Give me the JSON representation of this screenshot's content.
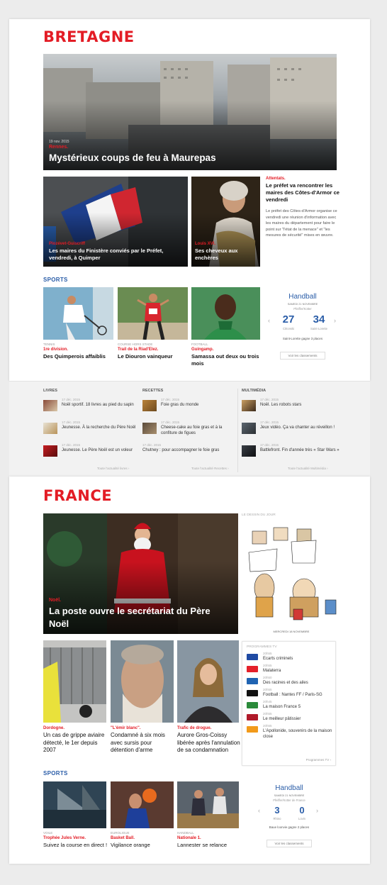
{
  "bretagne": {
    "title": "BRETAGNE",
    "hero": {
      "date": "19 nov. 2015",
      "kicker": "Rennes.",
      "title": "Mystérieux coups de feu à Maurepas"
    },
    "story2": {
      "kicker": "Plozévet-Guiscriff",
      "title": "Les maires du Finistère conviés par le Préfet, vendredi, à Quimper"
    },
    "story3": {
      "kicker": "Louis XVI.",
      "title": "Ses cheveux aux enchères"
    },
    "side": {
      "kicker": "Attentats.",
      "title": "Le préfet va rencontrer les maires des Côtes-d'Armor ce vendredi",
      "body": "Le préfet des Côtes-d'Armor organise ce vendredi une réunion d'information avec les maires du département pour faire le point sur \"l'état de la menace\" et \"les mesures de sécurité\" mises en œuvre."
    },
    "sports": {
      "heading": "SPORTS",
      "items": [
        {
          "cat": "TENNIS",
          "kicker": "1re division.",
          "title": "Des Quimperois affaiblis"
        },
        {
          "cat": "COURSE HORS STADE",
          "kicker": "Trail de la Riad'Elez.",
          "title": "Le Diouron vainqueur"
        },
        {
          "cat": "FOOTBALL",
          "kicker": "Guingamp.",
          "title": "Samassa out deux ou trois mois"
        }
      ],
      "widget": {
        "sport": "Handball",
        "date": "SAMEDI 21 NOVEMBRE",
        "league": "Pfeiffer/Kotter",
        "home_score": "27",
        "away_score": "34",
        "home_team": "Cléonski",
        "away_team": "Saint-Lorette",
        "summary": "Saint-Lorette gagne 3 places",
        "button": "Voir les classements"
      }
    }
  },
  "culture": {
    "livres": {
      "heading": "LIVRES",
      "items": [
        {
          "date": "17 déc. 2015",
          "text": "Noël sportif. 18 livres au pied du sapin"
        },
        {
          "date": "17 déc. 2015",
          "text": "Jeunesse. À la recherche du Père Noël"
        },
        {
          "date": "17 déc. 2015",
          "text": "Jeunesse. Le Père Noël est un voleur"
        }
      ],
      "more": "Toute l'actualité livres ›"
    },
    "recettes": {
      "heading": "RECETTES",
      "items": [
        {
          "date": "17 déc. 2015",
          "text": "Foie gras du monde"
        },
        {
          "date": "17 déc. 2015",
          "text": "Cheese-cake au foie gras et à la confiture de figues"
        },
        {
          "date": "17 déc. 2015",
          "text": "Chutney : pour accompagner le foie gras"
        }
      ],
      "more": "Toute l'actualité Recettes ›"
    },
    "multimedia": {
      "heading": "MULTIMÉDIA",
      "items": [
        {
          "date": "17 déc. 2015",
          "text": "Noël. Les robots stars"
        },
        {
          "date": "17 déc. 2015",
          "text": "Jeux vidéo. Ça va chanter au réveillon !"
        },
        {
          "date": "17 déc. 2015",
          "text": "Battlefront. Fin d'année très « Star Wars »"
        }
      ],
      "more": "Toute l'actualité Multimédia ›"
    }
  },
  "france": {
    "title": "FRANCE",
    "dessin_label": "LE DESSIN DU JOUR",
    "dessin_date": "MERCREDI 18 NOVEMBRE",
    "hero": {
      "kicker": "Noël.",
      "title": "La poste ouvre le secrétariat du Père Noël"
    },
    "stories": [
      {
        "kicker": "Dordogne.",
        "title": "Un cas de grippe aviaire détecté, le 1er depuis 2007"
      },
      {
        "kicker": "\"L'émir blanc\".",
        "title": "Condamné à six mois avec sursis pour détention d'arme"
      },
      {
        "kicker": "Trafic de drogue.",
        "title": "Aurore Gros-Coissy libérée après l'annulation de sa condamnation"
      }
    ],
    "programmes": {
      "heading": "PROGRAMMES TV",
      "items": [
        {
          "time": "20h55",
          "title": "Ecarts criminels"
        },
        {
          "time": "20h55",
          "title": "Malaterra"
        },
        {
          "time": "20h50",
          "title": "Des racines et des ailes"
        },
        {
          "time": "20h55",
          "title": "Football : Nantes FF / Paris-SG"
        },
        {
          "time": "20h45",
          "title": "La maison France 5"
        },
        {
          "time": "20h55",
          "title": "Le meilleur pâtissier"
        },
        {
          "time": "20h55",
          "title": "L'Apollonide, souvenirs de la maison close"
        }
      ],
      "more": "Programmes TV ›"
    },
    "sports": {
      "heading": "SPORTS",
      "items": [
        {
          "cat": "VOILE",
          "kicker": "Trophée Jules Verne.",
          "title": "Suivez la course en direct !"
        },
        {
          "cat": "EUROLIGUE",
          "kicker": "Basket Ball.",
          "title": "Vigilance orange"
        },
        {
          "cat": "HANDBALL",
          "kicker": "Nationale 1.",
          "title": "Lannester se relance"
        }
      ],
      "widget": {
        "sport": "Handball",
        "date": "SAMEDI 21 NOVEMBRE",
        "league": "Pfeiffer/Kotter de France",
        "home_score": "3",
        "away_score": "0",
        "home_team": "Rhino",
        "away_team": "Lovin",
        "summary": "Baue loonvie gagne 2 places",
        "button": "Voir les classements"
      }
    }
  }
}
